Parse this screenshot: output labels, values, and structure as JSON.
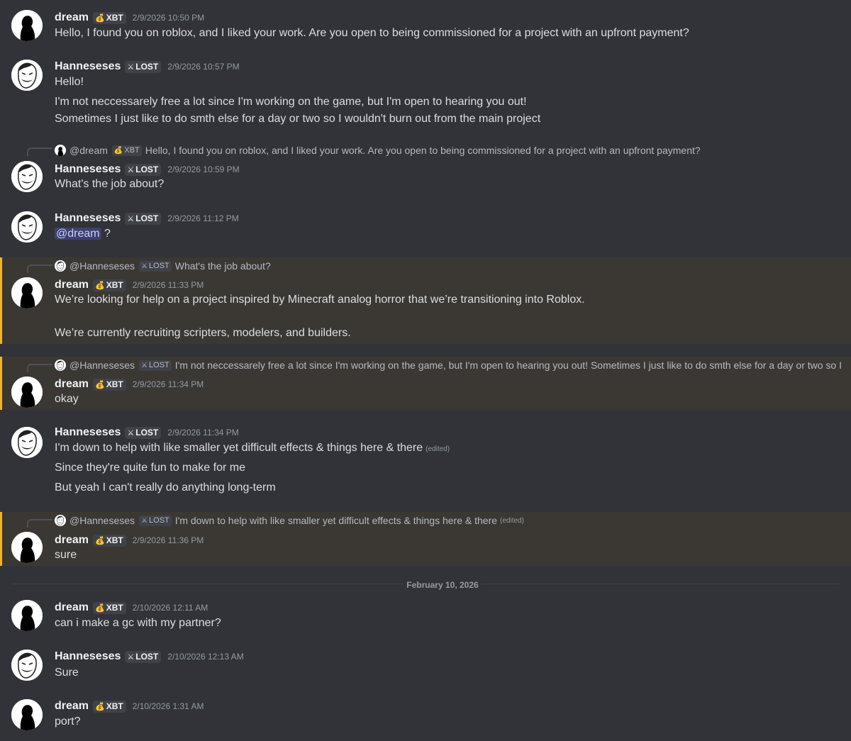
{
  "users": {
    "dream": {
      "name": "dream",
      "tag": "XBT",
      "tag_icon": "money-bag-icon"
    },
    "hann": {
      "name": "Hanneseses",
      "tag": "LOST",
      "tag_icon": "crossed-swords-icon"
    }
  },
  "messages": [
    {
      "author": "dream",
      "time": "2/9/2026 10:50 PM",
      "lines": [
        "Hello, I found you on roblox, and I liked your work. Are you open to being commissioned for a project with an upfront payment?"
      ]
    },
    {
      "author": "Hanneseses",
      "time": "2/9/2026 10:57 PM",
      "lines": [
        "Hello!",
        "I'm not neccessarely free a lot since I'm working on the game, but I'm open to hearing you out!",
        "Sometimes I just like to do smth else for a day or two so I wouldn't burn out from the main project"
      ]
    },
    {
      "reply": {
        "name": "@dream",
        "tag": "XBT",
        "text": "Hello, I found you on roblox, and I liked your work. Are you open to being commissioned for a project with an upfront payment?"
      },
      "author": "Hanneseses",
      "time": "2/9/2026 10:59 PM",
      "lines": [
        "What's the job about?"
      ]
    },
    {
      "author": "Hanneseses",
      "time": "2/9/2026 11:12 PM",
      "mention": "@dream",
      "after_mention": " ?"
    },
    {
      "reply": {
        "name": "@Hanneseses",
        "tag": "LOST",
        "text": "What's the job about?"
      },
      "author": "dream",
      "time": "2/9/2026 11:33 PM",
      "lines": [
        "We’re looking for help on a project inspired by Minecraft analog horror that we’re transitioning into Roblox.",
        "We’re currently recruiting scripters, modelers, and builders."
      ]
    },
    {
      "reply": {
        "name": "@Hanneseses",
        "tag": "LOST",
        "text": "I'm not neccessarely free a lot since I'm working on the game, but I'm open to hearing you out! Sometimes I just like to do smth else for a day or two so I"
      },
      "author": "dream",
      "time": "2/9/2026 11:34 PM",
      "lines": [
        "okay"
      ]
    },
    {
      "author": "Hanneseses",
      "time": "2/9/2026 11:34 PM",
      "lines": [
        "I'm down to help with like smaller yet difficult effects & things here & there",
        "Since they're quite fun to make for me",
        "But yeah I can't really do anything long-term"
      ],
      "edited": "(edited)"
    },
    {
      "reply": {
        "name": "@Hanneseses",
        "tag": "LOST",
        "text": "I'm down to help with like smaller yet difficult effects & things here & there",
        "edited": "(edited)"
      },
      "author": "dream",
      "time": "2/9/2026 11:36 PM",
      "lines": [
        "sure"
      ]
    },
    {
      "author": "dream",
      "time": "2/10/2026 12:11 AM",
      "lines": [
        "can i make a gc with my partner?"
      ]
    },
    {
      "author": "Hanneseses",
      "time": "2/10/2026 12:13 AM",
      "lines": [
        "Sure"
      ]
    },
    {
      "author": "dream",
      "time": "2/10/2026 1:31 AM",
      "lines": [
        "port?"
      ]
    }
  ],
  "date_divider": "February 10, 2026",
  "colors": {
    "background": "#313338",
    "highlight": "#3b3834",
    "highlight_bar": "#f0b232",
    "mention_bg": "#3c4270"
  }
}
